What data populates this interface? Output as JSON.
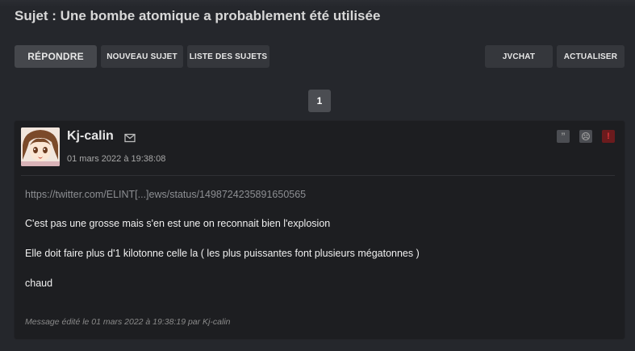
{
  "topic": {
    "title": "Sujet : Une bombe atomique a probablement été utilisée"
  },
  "toolbar": {
    "reply_label": "RÉPONDRE",
    "new_topic_label": "NOUVEAU SUJET",
    "topic_list_label": "LISTE DES SUJETS",
    "jvchat_label": "JVCHAT",
    "refresh_label": "ACTUALISER"
  },
  "pagination": {
    "current_page": "1"
  },
  "post": {
    "author": "Kj-calin",
    "date": "01 mars 2022 à 19:38:08",
    "link": "https://twitter.com/ELINT[...]ews/status/1498724235891650565",
    "paragraphs": [
      "C'est pas une grosse mais s'en est une on reconnait bien l'explosion",
      "Elle doit faire plus d'1 kilotonne celle la ( les plus puissantes font plusieurs mégatonnes )",
      "chaud"
    ],
    "edited_note": "Message édité le 01 mars 2022 à 19:38:19 par Kj-calin",
    "actions": {
      "quote_icon": "quote-icon",
      "blacklist_icon": "blacklist-icon",
      "report_icon": "report-icon",
      "quote_glyph": "”",
      "blacklist_glyph": "☹",
      "report_glyph": "!"
    }
  },
  "colors": {
    "background": "#25272c",
    "post_background": "#1d1e21",
    "button": "#35373c",
    "report_accent": "#e0353a"
  }
}
